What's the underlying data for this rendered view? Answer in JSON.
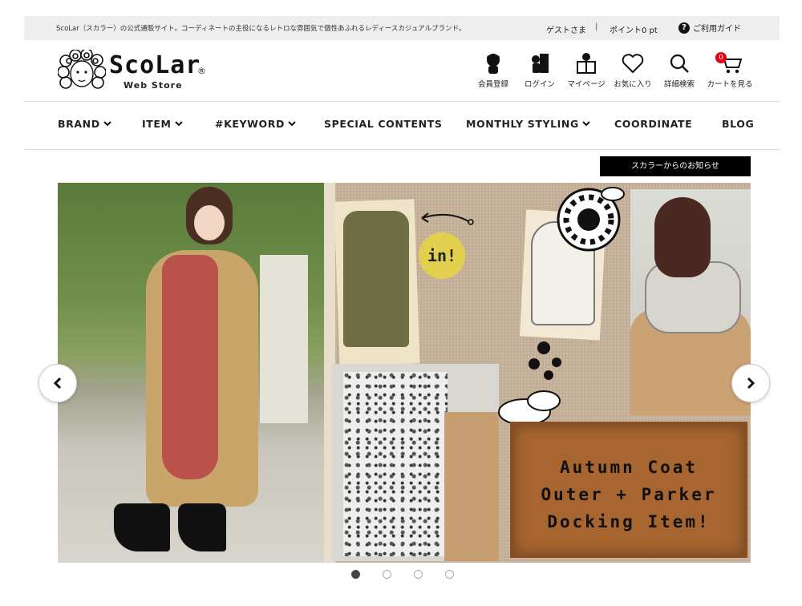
{
  "topbar": {
    "tagline": "ScoLar（スカラー）の公式通販サイト。コーディネートの主役になるレトロな雰囲気で個性あふれるレディースカジュアルブランド。",
    "guest": "ゲストさま",
    "separator": "|",
    "points": "ポイント0 pt",
    "guide": "ご利用ガイド"
  },
  "logo": {
    "wordmark": "ScoLar",
    "registered": "®",
    "subtitle": "Web Store"
  },
  "header_icons": [
    {
      "label": "会員登録",
      "icon": "member-register-icon"
    },
    {
      "label": "ログイン",
      "icon": "login-icon"
    },
    {
      "label": "マイページ",
      "icon": "mypage-icon"
    },
    {
      "label": "お気に入り",
      "icon": "heart-icon"
    },
    {
      "label": "詳細検索",
      "icon": "search-icon"
    },
    {
      "label": "カートを見る",
      "icon": "cart-icon"
    }
  ],
  "cart_count": "0",
  "nav": {
    "brand": "BRAND",
    "item": "ITEM",
    "keyword": "#KEYWORD",
    "special": "SPECIAL CONTENTS",
    "monthly": "MONTHLY STYLING",
    "coordinate": "COORDINATE",
    "blog": "BLOG"
  },
  "notice_button": "スカラーからのお知らせ",
  "banner": {
    "badge": "in!",
    "board_lines": [
      "Autumn Coat",
      "Outer + Parker",
      "Docking Item!"
    ]
  },
  "carousel": {
    "slides": 4,
    "active_index": 0
  }
}
